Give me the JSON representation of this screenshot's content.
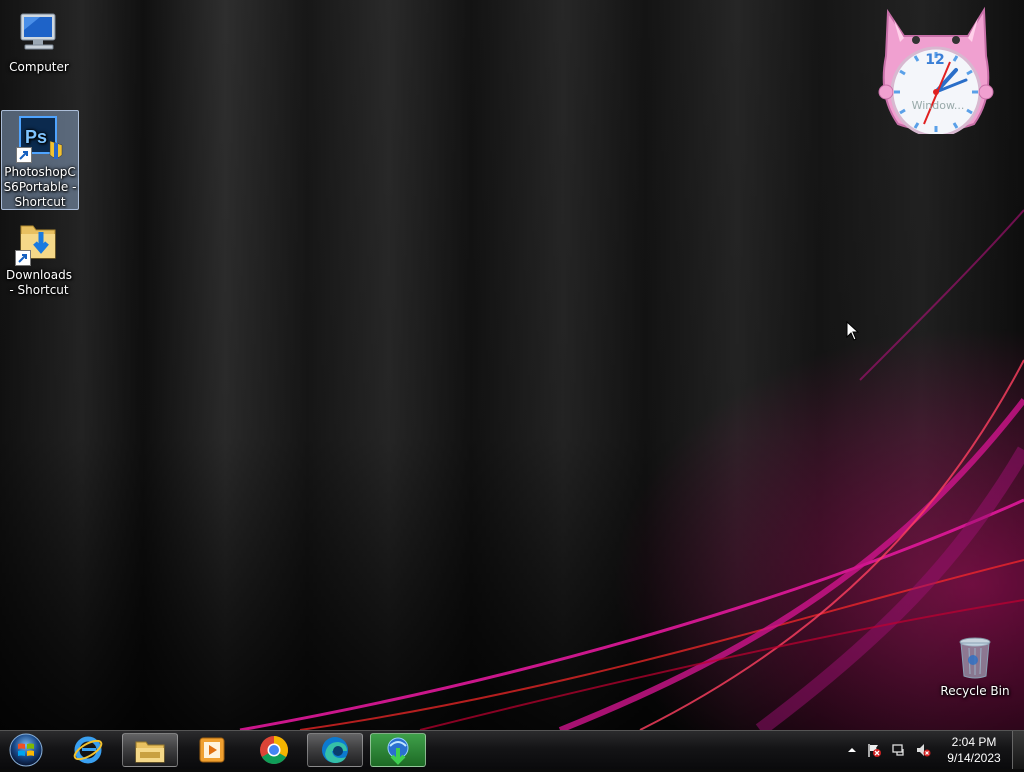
{
  "desktop": {
    "icons": [
      {
        "label": "Computer"
      },
      {
        "label": "PhotoshopCS6Portable - Shortcut"
      },
      {
        "label": "Downloads - Shortcut"
      },
      {
        "label": "Recycle Bin"
      }
    ]
  },
  "gadget": {
    "clock_label": "Window...",
    "clock_twelve": "12"
  },
  "taskbar": {
    "pinned": [
      {
        "icon": "internet-explorer-icon"
      },
      {
        "icon": "file-explorer-icon"
      },
      {
        "icon": "media-player-icon"
      },
      {
        "icon": "chrome-icon"
      },
      {
        "icon": "edge-icon"
      },
      {
        "icon": "download-manager-icon"
      }
    ],
    "tray": {
      "time": "2:04 PM",
      "date": "9/14/2023"
    }
  },
  "colors": {
    "taskbar": "#141416",
    "selection": "#a0bee6",
    "wallpaper_accent": "#d0148c"
  }
}
